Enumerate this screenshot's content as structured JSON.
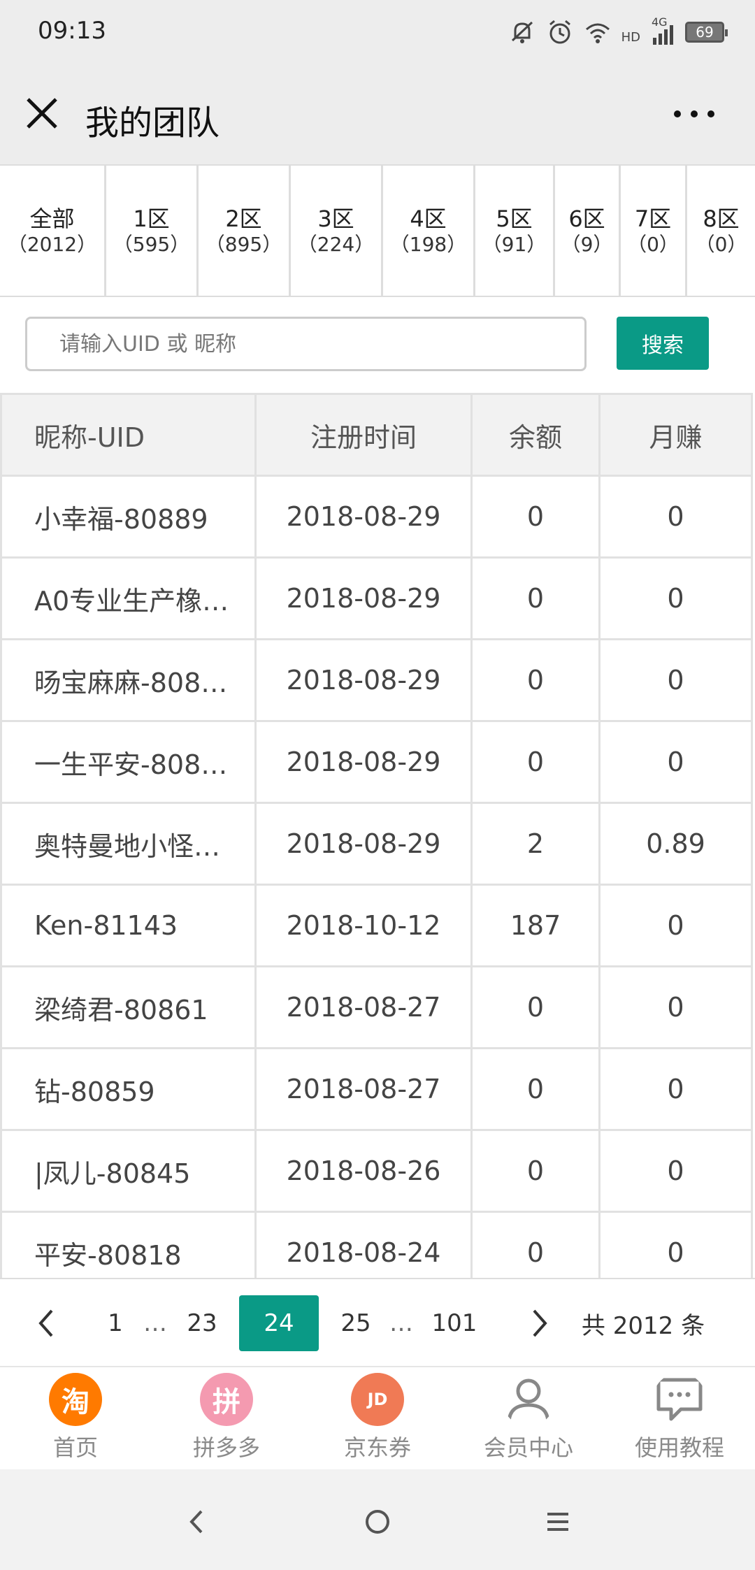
{
  "status_bar": {
    "time": "09:13",
    "network": "4G",
    "hd": "HD",
    "battery": "69"
  },
  "nav": {
    "title": "我的团队"
  },
  "zones": [
    {
      "label": "全部",
      "count": "（2012）"
    },
    {
      "label": "1区",
      "count": "（595）"
    },
    {
      "label": "2区",
      "count": "（895）"
    },
    {
      "label": "3区",
      "count": "（224）"
    },
    {
      "label": "4区",
      "count": "（198）"
    },
    {
      "label": "5区",
      "count": "（91）"
    },
    {
      "label": "6区",
      "count": "（9）"
    },
    {
      "label": "7区",
      "count": "（0）"
    },
    {
      "label": "8区",
      "count": "（0）"
    }
  ],
  "search": {
    "placeholder": "请输入UID 或 昵称",
    "button": "搜索"
  },
  "table": {
    "headers": [
      "昵称-UID",
      "注册时间",
      "余额",
      "月赚"
    ],
    "rows": [
      [
        "小幸福-80889",
        "2018-08-29",
        "0",
        "0"
      ],
      [
        "A0专业生产橡…",
        "2018-08-29",
        "0",
        "0"
      ],
      [
        "旸宝麻麻-808…",
        "2018-08-29",
        "0",
        "0"
      ],
      [
        "一生平安-808…",
        "2018-08-29",
        "0",
        "0"
      ],
      [
        "奥特曼地小怪…",
        "2018-08-29",
        "2",
        "0.89"
      ],
      [
        "Ken-81143",
        "2018-10-12",
        "187",
        "0"
      ],
      [
        "梁绮君-80861",
        "2018-08-27",
        "0",
        "0"
      ],
      [
        "钻-80859",
        "2018-08-27",
        "0",
        "0"
      ],
      [
        "|凤儿-80845",
        "2018-08-26",
        "0",
        "0"
      ],
      [
        "平安-80818",
        "2018-08-24",
        "0",
        "0"
      ]
    ]
  },
  "pagination": {
    "first": "1",
    "ellipsis": "…",
    "prev_page": "23",
    "current": "24",
    "next_page": "25",
    "last": "101",
    "total": "共 2012 条"
  },
  "bottom_tabs": [
    {
      "label": "首页",
      "glyph": "淘",
      "icon": "taobao-icon",
      "color": "#ff7a00"
    },
    {
      "label": "拼多多",
      "glyph": "拼",
      "icon": "pinduoduo-icon",
      "color": "#f49ab0"
    },
    {
      "label": "京东券",
      "glyph": "JD",
      "icon": "jd-icon",
      "color": "#f07a55"
    },
    {
      "label": "会员中心",
      "icon": "user-icon"
    },
    {
      "label": "使用教程",
      "icon": "chat-icon"
    }
  ],
  "colors": {
    "accent": "#0a9a86",
    "bar_bg": "#ededed"
  }
}
